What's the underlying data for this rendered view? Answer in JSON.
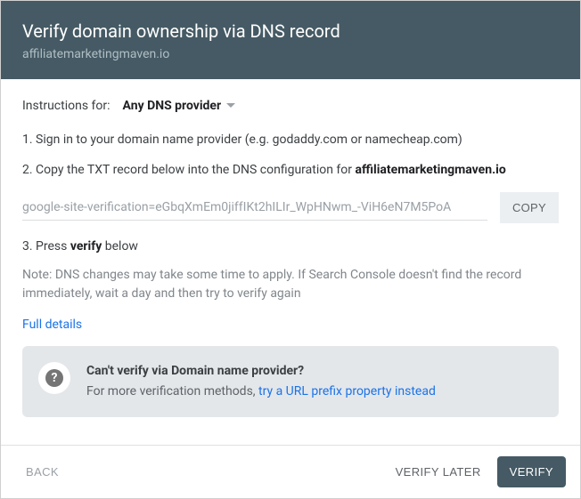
{
  "header": {
    "title": "Verify domain ownership via DNS record",
    "subtitle": "affiliatemarketingmaven.io"
  },
  "instructions": {
    "label": "Instructions for:",
    "provider": "Any DNS provider"
  },
  "steps": {
    "one": "1. Sign in to your domain name provider (e.g. godaddy.com or namecheap.com)",
    "two_prefix": "2. Copy the TXT record below into the DNS configuration for ",
    "two_domain": "affiliatemarketingmaven.io",
    "three_prefix": "3. Press ",
    "three_bold": "verify",
    "three_suffix": " below"
  },
  "record": {
    "value": "google-site-verification=eGbqXmEm0jiffIKt2hILIr_WpHNwm_-ViH6eN7M5PoA",
    "copy_label": "COPY"
  },
  "note": "Note: DNS changes may take some time to apply. If Search Console doesn't find the record immediately, wait a day and then try to verify again",
  "full_details": "Full details",
  "info": {
    "title": "Can't verify via Domain name provider?",
    "body_prefix": "For more verification methods, ",
    "link": "try a URL prefix property instead"
  },
  "footer": {
    "back": "BACK",
    "verify_later": "VERIFY LATER",
    "verify": "VERIFY"
  }
}
